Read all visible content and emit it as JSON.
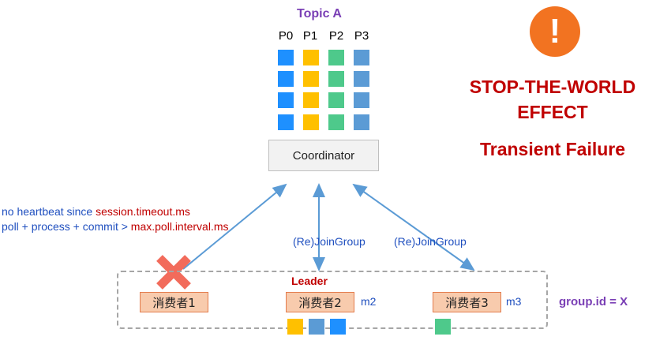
{
  "topic": {
    "title": "Topic A",
    "partitions": [
      "P0",
      "P1",
      "P2",
      "P3"
    ],
    "colors": [
      "#1e90ff",
      "#ffc000",
      "#4ec98b",
      "#5b9bd5"
    ]
  },
  "coordinator": {
    "label": "Coordinator"
  },
  "consumers": [
    {
      "label": "消费者1",
      "member": ""
    },
    {
      "label": "消费者2",
      "member": "m2"
    },
    {
      "label": "消费者3",
      "member": "m3"
    }
  ],
  "leader_label": "Leader",
  "group_id": "group.id = X",
  "rejoin_left": "(Re)JoinGroup",
  "rejoin_right": "(Re)JoinGroup",
  "notes": {
    "line1_prefix": "no heartbeat since ",
    "line1_config": "session.timeout.ms",
    "line2_prefix": "poll + process + commit > ",
    "line2_config": "max.poll.interval.ms"
  },
  "alert_symbol": "!",
  "stop_the_world_line1": "STOP-THE-WORLD",
  "stop_the_world_line2": "EFFECT",
  "transient_failure": "Transient Failure",
  "assigned": {
    "consumer2": [
      "#ffc000",
      "#5b9bd5",
      "#1e90ff"
    ],
    "consumer3": [
      "#4ec98b"
    ]
  },
  "accent_colors": {
    "arrow": "#5b9bd5",
    "failure": "#f26b5b",
    "title": "#7a3fb5",
    "alert": "#c00000"
  }
}
